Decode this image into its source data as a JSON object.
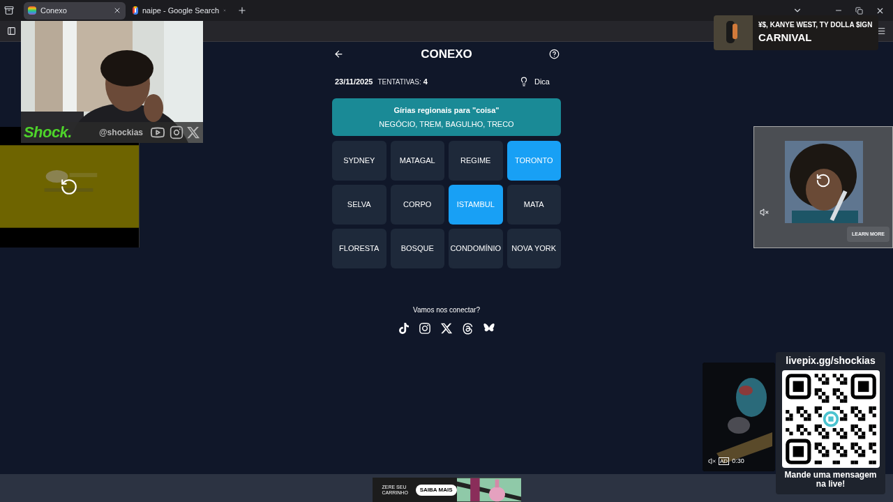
{
  "browser": {
    "tabs": [
      {
        "label": "Conexo",
        "selected": true
      },
      {
        "label": "naipe - Google Search",
        "selected": false
      }
    ]
  },
  "game": {
    "title": "CONEXO",
    "date": "23/11/2025",
    "attempts_label": "TENTATIVAS:",
    "attempts": "4",
    "hint": "Dica",
    "solved_groups": [
      {
        "title": "Gírias regionais para \"coisa\"",
        "words": "NEGÓCIO, TREM, BAGULHO, TRECO",
        "color": "#1a8a96"
      }
    ],
    "tiles": [
      {
        "word": "SYDNEY",
        "selected": false
      },
      {
        "word": "MATAGAL",
        "selected": false
      },
      {
        "word": "REGIME",
        "selected": false
      },
      {
        "word": "TORONTO",
        "selected": true
      },
      {
        "word": "SELVA",
        "selected": false
      },
      {
        "word": "CORPO",
        "selected": false
      },
      {
        "word": "ISTAMBUL",
        "selected": true
      },
      {
        "word": "MATA",
        "selected": false
      },
      {
        "word": "FLORESTA",
        "selected": false
      },
      {
        "word": "BOSQUE",
        "selected": false
      },
      {
        "word": "CONDOMÍNIO",
        "selected": false
      },
      {
        "word": "NOVA YORK",
        "selected": false
      }
    ],
    "social_label": "Vamos nos conectar?"
  },
  "overlays": {
    "webcam": {
      "logo": "Shock.",
      "handle": "@shockias"
    },
    "now_playing": {
      "artist": "¥$, KANYE WEST, TY DOLLA $IGN",
      "title": "CARNIVAL"
    },
    "video_ad": {
      "button": "LEARN MORE"
    },
    "side_video": {
      "badge": "AD",
      "time": "0:30"
    },
    "donation": {
      "url": "livepix.gg/shockias",
      "message": "Mande uma mensagem na live!"
    },
    "banner_ad": {
      "headline": "ZERE SEU CARRINHO",
      "button": "SAIBA MAIS"
    }
  }
}
